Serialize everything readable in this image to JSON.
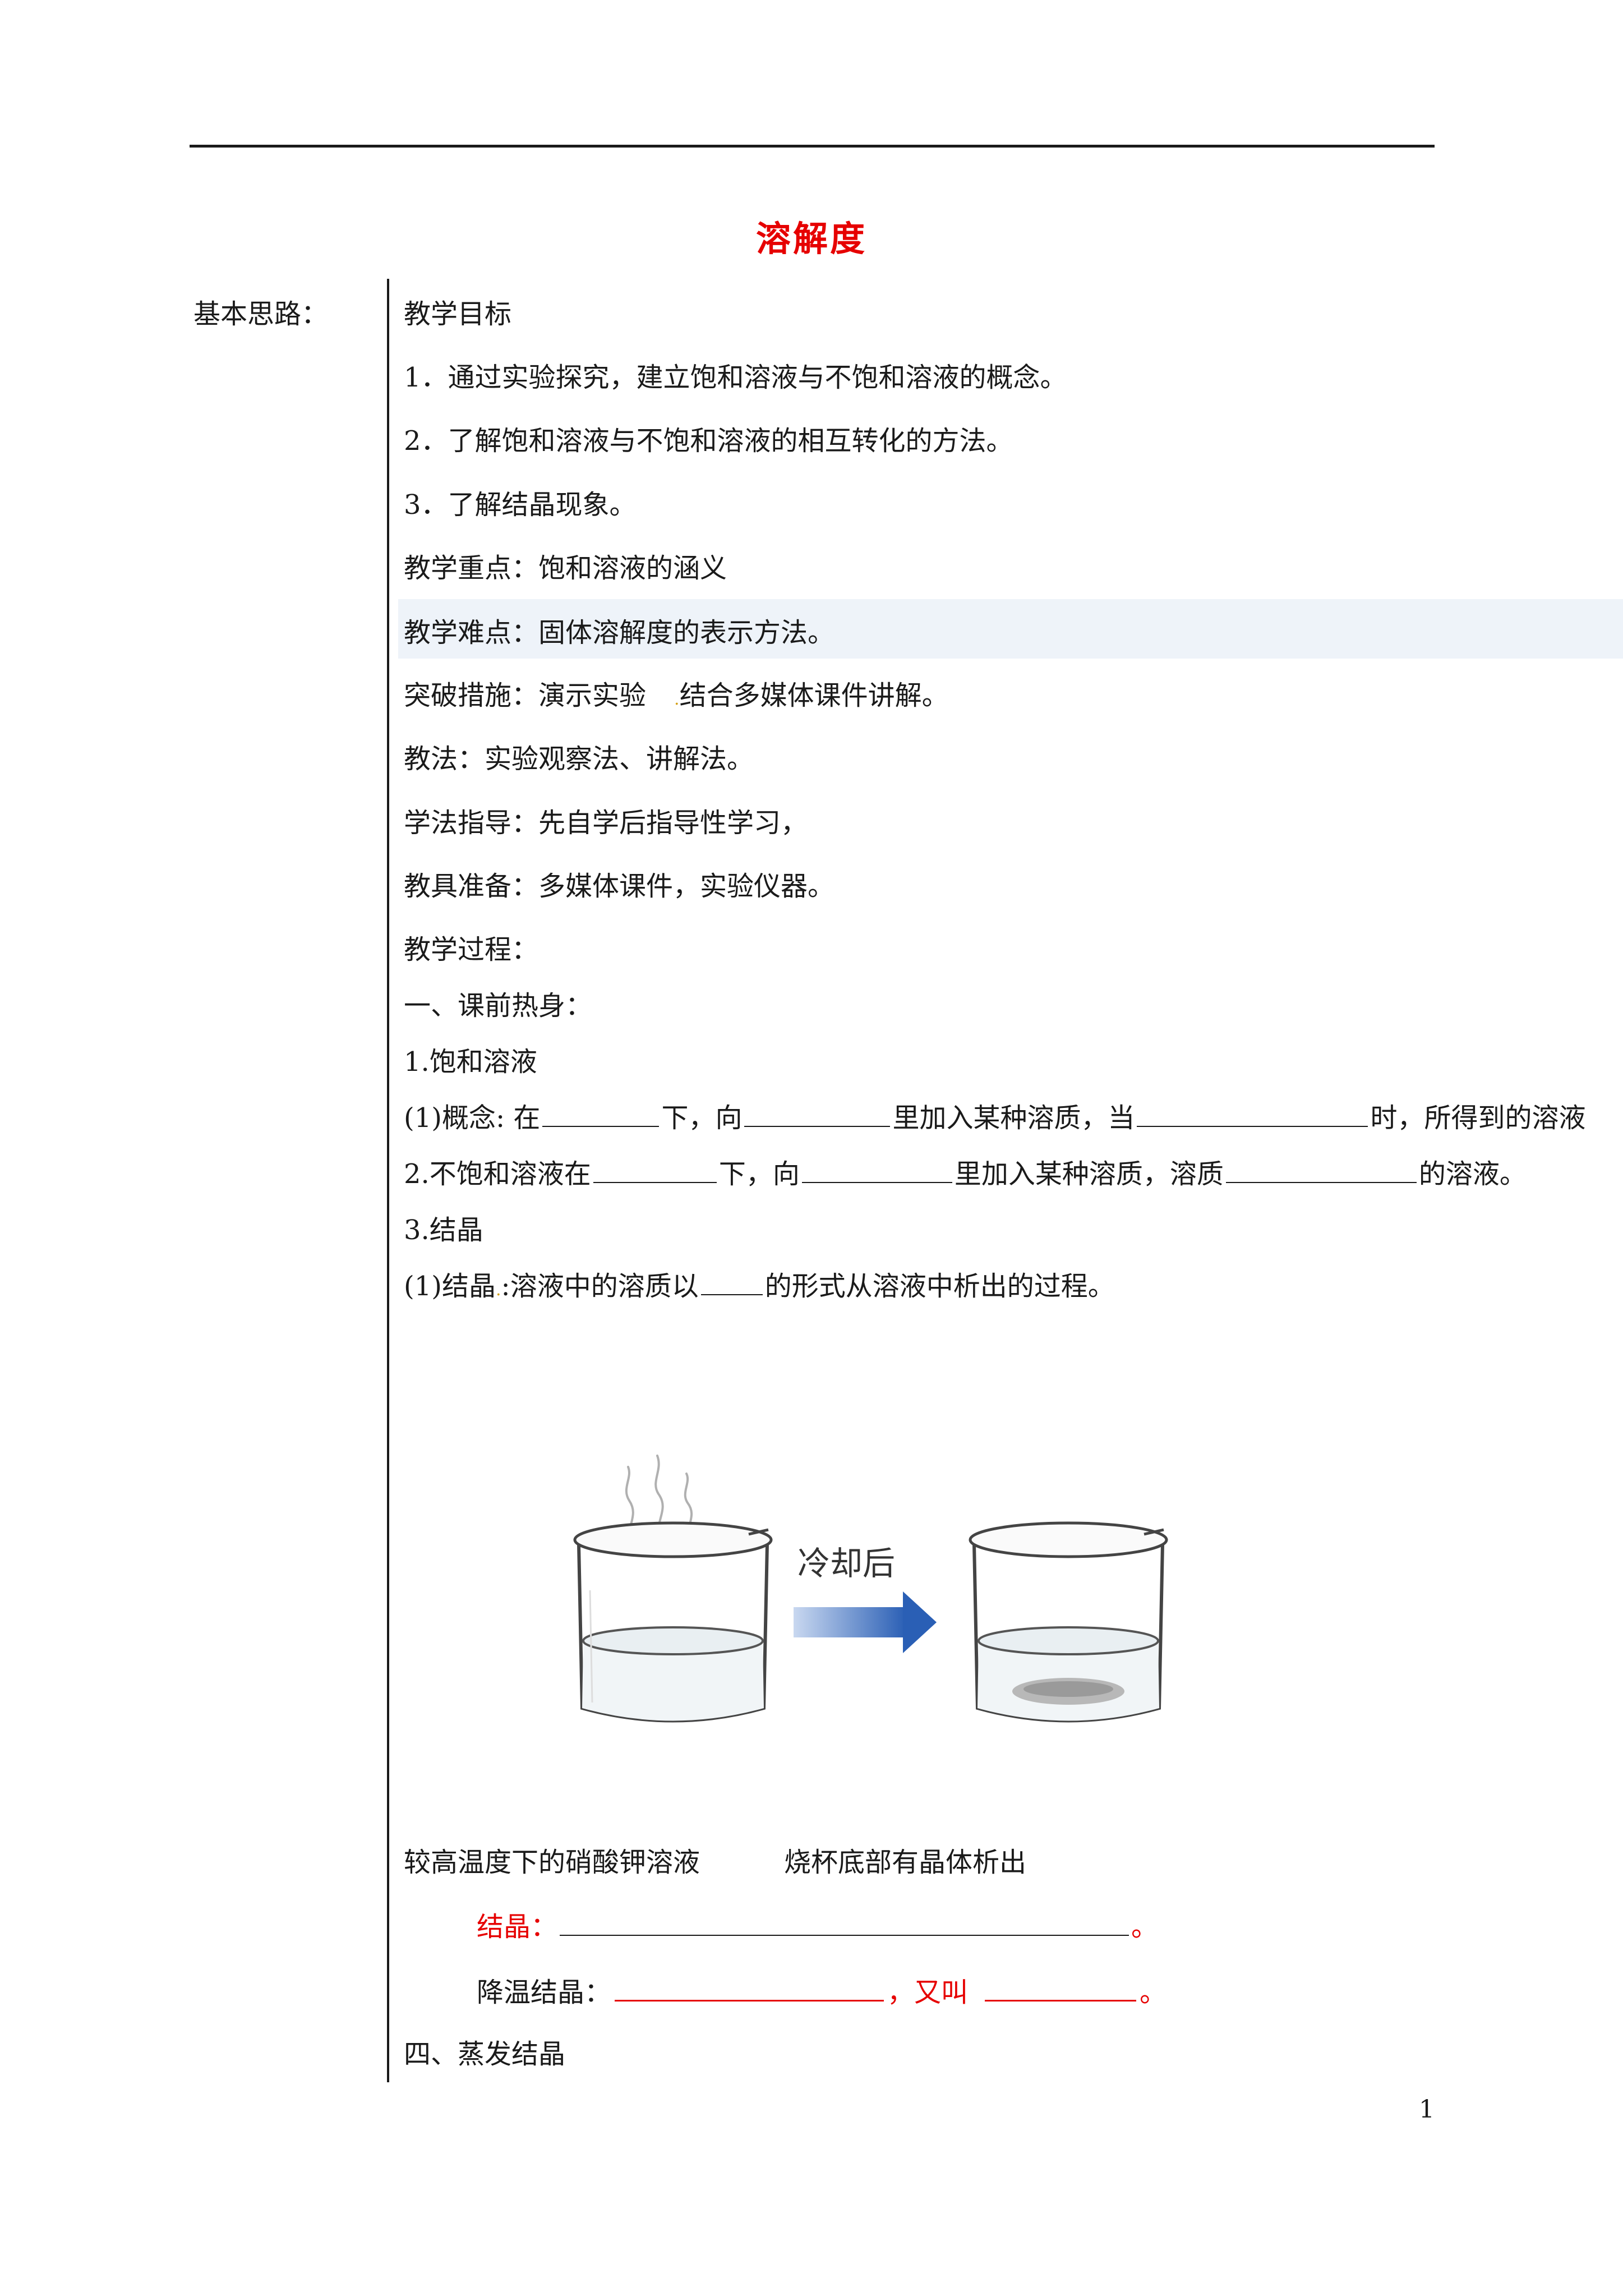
{
  "title": "溶解度",
  "side_label": "基本思路：",
  "goals_heading": "教学目标",
  "goal_1": "1．通过实验探究，建立饱和溶液与不饱和溶液的概念。",
  "goal_2": "2．了解饱和溶液与不饱和溶液的相互转化的方法。",
  "goal_3": "3．了解结晶现象。",
  "key_point": "教学重点：饱和溶液的涵义",
  "difficult_point": "教学难点：固体溶解度的表示方法。",
  "breakthrough_a": "突破措施：演示实验",
  "breakthrough_b": "结合多媒体课件讲解。",
  "method": "教法：实验观察法、讲解法。",
  "study_guide": "学法指导：先自学后指导性学习，",
  "tools": "教具准备：多媒体课件，实验仪器。",
  "process": "教学过程：",
  "section_1": "一、课前热身：",
  "item_1": "1.饱和溶液",
  "concept": {
    "p1": "(1)概念: 在",
    "p2": "下，向",
    "p3": "里加入某种溶质，当",
    "p4": "时，所得到的溶液"
  },
  "unsat": {
    "p1": "2.不饱和溶液在",
    "p2": "下，向",
    "p3": "里加入某种溶质，溶质",
    "p4": "的溶液。"
  },
  "item_3": "3.结晶",
  "crystal_def": {
    "p1": "(1)结晶",
    "p2": ":溶液中的溶质以",
    "p3": "的形式从溶液中析出的过程。"
  },
  "figure": {
    "arrow_label": "冷却后",
    "arrow_color": "#2a5fb5",
    "caption_left": "较高温度下的硝酸钾溶液",
    "caption_right": "烧杯底部有晶体析出"
  },
  "crystal_fill": {
    "label": "结晶：",
    "end": "。"
  },
  "cooling_fill": {
    "label": "降温结晶：",
    "mid": "，又叫",
    "end": "。"
  },
  "section_4": "四、蒸发结晶",
  "page_number": "1"
}
